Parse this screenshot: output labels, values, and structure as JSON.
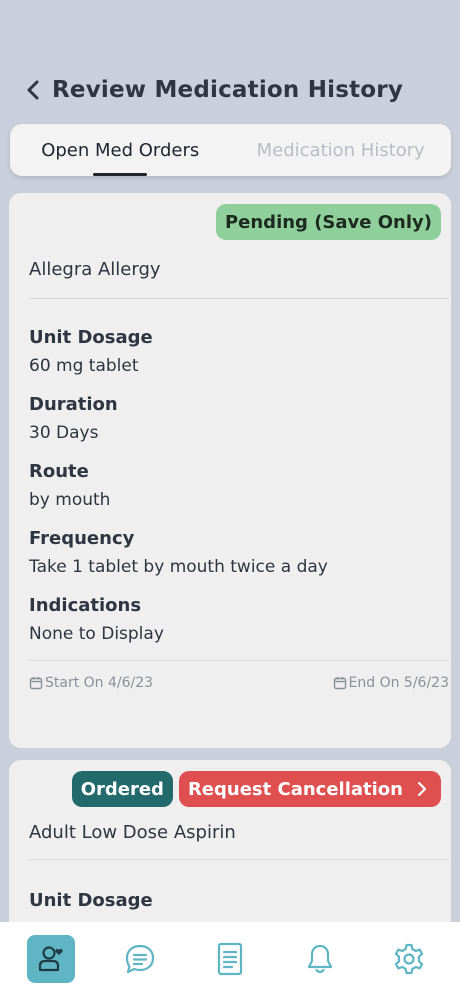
{
  "header": {
    "title": "Review Medication History"
  },
  "tabs": [
    {
      "label": "Open Med Orders",
      "active": true
    },
    {
      "label": "Medication History",
      "active": false
    }
  ],
  "orders": [
    {
      "status": "Pending (Save Only)",
      "name": "Allegra Allergy",
      "fields": [
        {
          "label": "Unit Dosage",
          "value": "60 mg tablet"
        },
        {
          "label": "Duration",
          "value": "30 Days"
        },
        {
          "label": "Route",
          "value": "by mouth"
        },
        {
          "label": "Frequency",
          "value": "Take 1 tablet by mouth twice a day"
        },
        {
          "label": "Indications",
          "value": "None to Display"
        }
      ],
      "start": "Start On 4/6/23",
      "end": "End On 5/6/23"
    },
    {
      "status": "Ordered",
      "action": "Request Cancellation",
      "name": "Adult Low Dose Aspirin",
      "fields": [
        {
          "label": "Unit Dosage",
          "value": ""
        }
      ]
    }
  ],
  "tabbar": {
    "items": [
      "profile-icon",
      "chat-icon",
      "document-icon",
      "bell-icon",
      "gear-icon"
    ],
    "active": "profile-icon"
  },
  "colors": {
    "accent": "#5fb5c4",
    "pending": "#8fcf9b",
    "ordered": "#226a6b",
    "cancel": "#e04f4f"
  }
}
